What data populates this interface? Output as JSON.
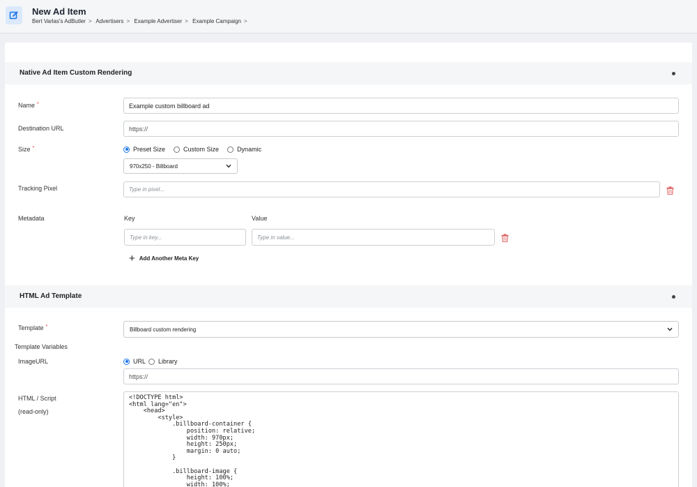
{
  "header": {
    "title": "New Ad Item",
    "icon": "edit-icon",
    "breadcrumb": [
      "Bert Varlas's AdButler",
      "Advertisers",
      "Example Advertiser",
      "Example Campaign"
    ],
    "separator": ">"
  },
  "native_section": {
    "title": "Native Ad Item Custom Rendering",
    "name": {
      "label": "Name",
      "value": "Example custom billboard ad"
    },
    "destination": {
      "label": "Destination URL",
      "value": "https://"
    },
    "size": {
      "label": "Size",
      "options": [
        "Preset Size",
        "Custom Size",
        "Dynamic"
      ],
      "selected": "Preset Size",
      "preset": "970x250 - Billboard"
    },
    "tracking": {
      "label": "Tracking Pixel",
      "placeholder": "Type in pixel..."
    },
    "metadata": {
      "label": "Metadata",
      "key_label": "Key",
      "value_label": "Value",
      "key_placeholder": "Type in key...",
      "value_placeholder": "Type in value...",
      "add_label": "Add Another Meta Key"
    }
  },
  "html_section": {
    "title": "HTML Ad Template",
    "template": {
      "label": "Template",
      "value": "Billboard custom rendering"
    },
    "variables_label": "Template Variables",
    "image_url": {
      "label": "ImageURL",
      "options": [
        "URL",
        "Library"
      ],
      "selected": "URL",
      "value": "https://"
    },
    "script": {
      "label": "HTML / Script",
      "sublabel": "(read-only)",
      "lines": [
        "<!DOCTYPE html>",
        "<html lang=\"en\">",
        "    <head>",
        "        <style>",
        "            .billboard-container {",
        "                position: relative;",
        "                width: 970px;",
        "                height: 250px;",
        "                margin: 0 auto;",
        "            }",
        "",
        "            .billboard-image {",
        "                height: 100%;",
        "                width: 100%;"
      ]
    }
  },
  "colors": {
    "accent": "#1a73e8",
    "danger": "#e06666",
    "required": "#e03131"
  }
}
